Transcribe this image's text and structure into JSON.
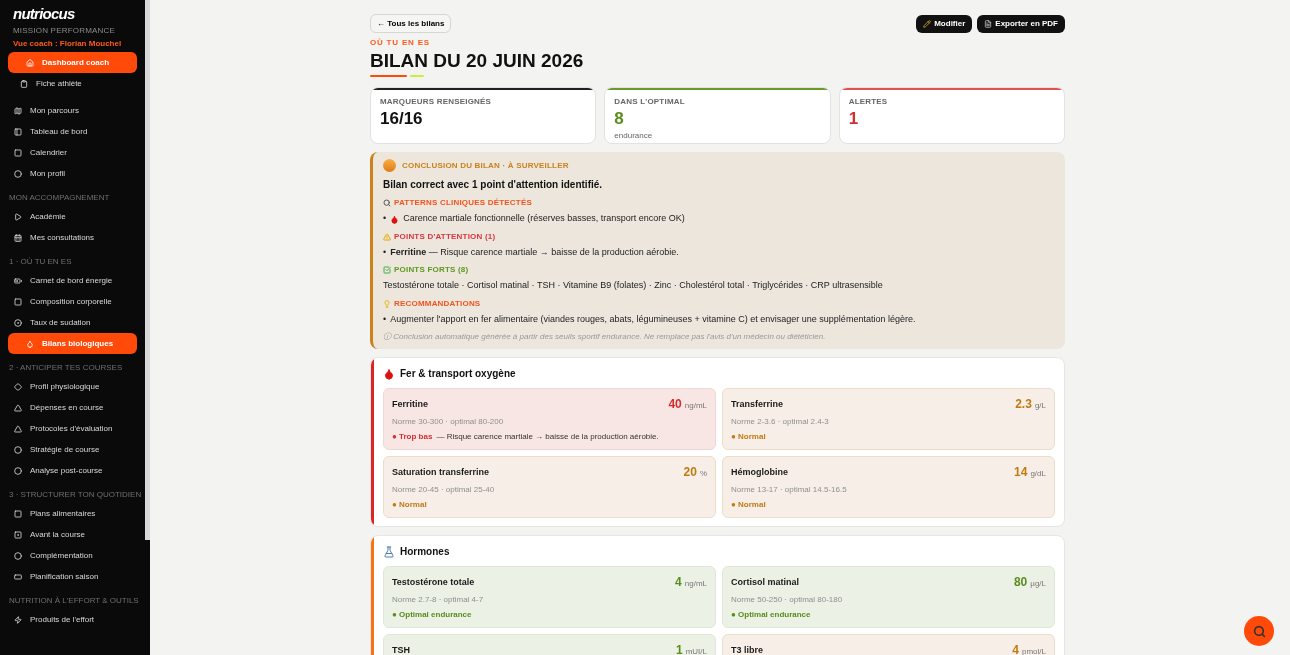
{
  "sidebar": {
    "logo": "nutriocus",
    "subtitle": "MISSION PERFORMANCE",
    "coach_view": "Vue coach : Florian Mouchel",
    "groups": [
      {
        "items": [
          {
            "label": "Dashboard coach",
            "selected": true
          },
          {
            "label": "Fiche athlète",
            "selected": false
          }
        ]
      },
      {
        "items": [
          {
            "label": "Mon parcours",
            "selected": false
          },
          {
            "label": "Tableau de bord",
            "selected": false
          },
          {
            "label": "Calendrier",
            "selected": false
          },
          {
            "label": "Mon profil",
            "selected": false
          }
        ]
      },
      {
        "title": "MON ACCOMPAGNEMENT",
        "items": [
          {
            "label": "Académie",
            "selected": false
          },
          {
            "label": "Mes consultations",
            "selected": false
          }
        ]
      },
      {
        "title": "1 · OÙ TU EN ES",
        "items": [
          {
            "label": "Carnet de bord énergie",
            "selected": false
          },
          {
            "label": "Composition corporelle",
            "selected": false
          },
          {
            "label": "Taux de sudation",
            "selected": false
          },
          {
            "label": "Bilans biologiques",
            "selected": true
          }
        ]
      },
      {
        "title": "2 · ANTICIPER TES COURSES",
        "items": [
          {
            "label": "Profil physiologique",
            "selected": false
          },
          {
            "label": "Dépenses en course",
            "selected": false
          },
          {
            "label": "Protocoles d'évaluation",
            "selected": false
          },
          {
            "label": "Stratégie de course",
            "selected": false
          },
          {
            "label": "Analyse post-course",
            "selected": false
          }
        ]
      },
      {
        "title": "3 · STRUCTURER TON QUOTIDIEN",
        "items": [
          {
            "label": "Plans alimentaires",
            "selected": false
          },
          {
            "label": "Avant la course",
            "selected": false
          },
          {
            "label": "Complémentation",
            "selected": false
          },
          {
            "label": "Planification saison",
            "selected": false
          }
        ]
      },
      {
        "title": "NUTRITION À L'EFFORT & OUTILS",
        "items": [
          {
            "label": "Produits de l'effort",
            "selected": false
          }
        ]
      }
    ]
  },
  "header": {
    "back": "← Tous les bilans",
    "actions": [
      "Modifier",
      "Exporter en PDF"
    ],
    "eyebrow": "OÙ TU EN ES",
    "title": "BILAN DU 20 JUIN 2026"
  },
  "stats": [
    {
      "label": "MARQUEURS RENSEIGNÉS",
      "value": "16/16",
      "kind": "neutral"
    },
    {
      "label": "DANS L'OPTIMAL",
      "value": "8",
      "sub": "endurance",
      "kind": "good"
    },
    {
      "label": "ALERTES",
      "value": "1",
      "kind": "alert"
    }
  ],
  "conclusion": {
    "title": "CONCLUSION DU BILAN · À SURVEILLER",
    "headline": "Bilan correct avec 1 point d'attention identifié.",
    "sections": [
      {
        "kind": "patterns",
        "title": "PATTERNS CLINIQUES DÉTECTÉS",
        "items": [
          {
            "bullet": "•",
            "text": "Carence martiale fonctionnelle (réserves basses, transport encore OK)"
          }
        ]
      },
      {
        "kind": "attention",
        "title": "POINTS D'ATTENTION (1)",
        "items": [
          {
            "bullet": "•",
            "text": "**Ferritine** — Risque carence martiale → baisse de la production aérobie."
          }
        ]
      },
      {
        "kind": "strengths",
        "title": "POINTS FORTS (8)",
        "items": [
          {
            "text": "Testostérone totale · Cortisol matinal · TSH · Vitamine B9 (folates) · Zinc · Cholestérol total · Triglycérides · CRP ultrasensible"
          }
        ]
      },
      {
        "kind": "recommendations",
        "title": "RECOMMANDATIONS",
        "items": [
          {
            "bullet": "•",
            "text": "Augmenter l'apport en fer alimentaire (viandes rouges, abats, légumineuses + vitamine C) et envisager une supplémentation légère."
          }
        ]
      }
    ],
    "disclaimer": "ⓘ Conclusion automatique générée à partir des seuils sportif endurance. Ne remplace pas l'avis d'un médecin ou diététicien."
  },
  "panels": [
    {
      "title": "Fer & transport oxygène",
      "color": "#dc2626",
      "markers": [
        {
          "name": "Ferritine",
          "value": "40",
          "unit": "ng/mL",
          "range": "Norme 30-300 · optimal 80-200",
          "kind": "low",
          "status_label": "● Trop bas",
          "note": "— Risque carence martiale → baisse de la production aérobie."
        },
        {
          "name": "Transferrine",
          "value": "2.3",
          "unit": "g/L",
          "range": "Norme 2-3.6 · optimal 2.4-3",
          "kind": "normal",
          "status_label": "● Normal"
        },
        {
          "name": "Saturation transferrine",
          "value": "20",
          "unit": "%",
          "range": "Norme 20-45 · optimal 25-40",
          "kind": "normal",
          "status_label": "● Normal"
        },
        {
          "name": "Hémoglobine",
          "value": "14",
          "unit": "g/dL",
          "range": "Norme 13-17 · optimal 14.5-16.5",
          "kind": "normal",
          "status_label": "● Normal"
        }
      ]
    },
    {
      "title": "Hormones",
      "color": "#f97316",
      "markers": [
        {
          "name": "Testostérone totale",
          "value": "4",
          "unit": "ng/mL",
          "range": "Norme 2.7-8 · optimal 4-7",
          "kind": "optimal",
          "status_label": "● Optimal endurance"
        },
        {
          "name": "Cortisol matinal",
          "value": "80",
          "unit": "µg/L",
          "range": "Norme 50-250 · optimal 80-180",
          "kind": "optimal",
          "status_label": "● Optimal endurance"
        },
        {
          "name": "TSH",
          "value": "1",
          "unit": "mUI/L",
          "kind": "optimal"
        },
        {
          "name": "T3 libre",
          "value": "4",
          "unit": "pmol/L",
          "kind": "normal"
        }
      ]
    }
  ]
}
